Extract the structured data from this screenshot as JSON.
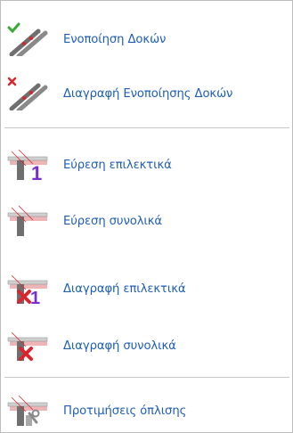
{
  "menu": {
    "items": [
      {
        "label": "Ενοποίηση Δοκών",
        "icon": "join-beams-icon"
      },
      {
        "label": "Διαγραφή Ενοποίησης Δοκών",
        "icon": "delete-beam-join-icon"
      },
      {
        "label": "Εύρεση επιλεκτικά",
        "icon": "find-selective-icon"
      },
      {
        "label": "Εύρεση συνολικά",
        "icon": "find-total-icon"
      },
      {
        "label": "Διαγραφή επιλεκτικά",
        "icon": "delete-selective-icon"
      },
      {
        "label": "Διαγραφή συνολικά",
        "icon": "delete-total-icon"
      },
      {
        "label": "Προτιμήσεις όπλισης",
        "icon": "reinforcement-preferences-icon"
      }
    ]
  },
  "colors": {
    "label_text": "#1e5eb8",
    "separator": "#c8c8c8",
    "beam_gray": "#7a7a7a",
    "accent_red": "#d9262e",
    "accent_green": "#3aa83a",
    "accent_purple": "#7a2fcc"
  }
}
